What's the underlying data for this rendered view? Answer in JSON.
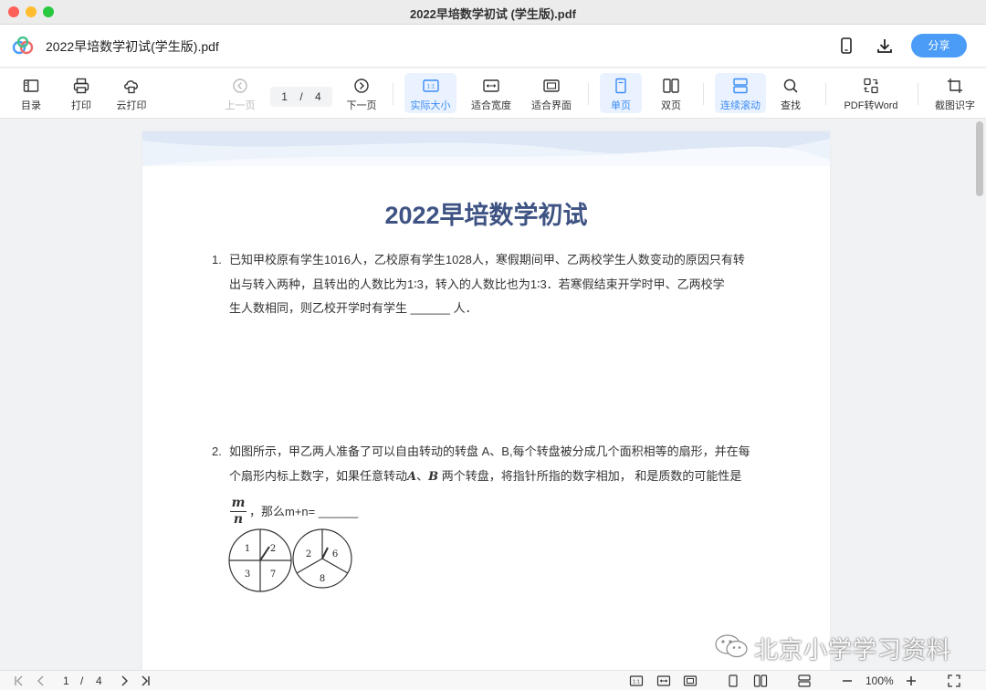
{
  "window": {
    "title": "2022早培数学初试 (学生版).pdf"
  },
  "header": {
    "doc_title": "2022早培数学初试(学生版).pdf",
    "share_label": "分享"
  },
  "toolbar": {
    "toc": "目录",
    "print": "打印",
    "cloud_print": "云打印",
    "prev_page": "上一页",
    "page_current": "1",
    "page_sep": "/",
    "page_total": "4",
    "next_page": "下一页",
    "actual_size": "实际大小",
    "fit_width": "适合宽度",
    "fit_page": "适合界面",
    "single_page": "单页",
    "double_page": "双页",
    "continuous_scroll": "连续滚动",
    "find": "查找",
    "pdf_to_word": "PDF转Word",
    "screenshot_ocr": "截图识字",
    "actual_size_badge": "1:1"
  },
  "document": {
    "title": "2022早培数学初试",
    "q1": {
      "num": "1.",
      "line1": "已知甲校原有学生1016人，乙校原有学生1028人，寒假期间甲、乙两校学生人数变动的原因只有转",
      "line2": "出与转入两种，且转出的人数比为1∶3，转入的人数比也为1∶3．若寒假结束开学时甲、乙两校学",
      "line3": "生人数相同，则乙校开学时有学生 ______ 人．"
    },
    "q2": {
      "num": "2.",
      "line1": "如图所示，甲乙两人准备了可以自由转动的转盘 A、B,每个转盘被分成几个面积相等的扇形，并在每",
      "line2_a": "个扇形内标上数字，如果任意转动",
      "line2_A": "A",
      "line2_sep": "、",
      "line2_B": "B",
      "line2_b": " 两个转盘，将指针所指的数字相加， 和是质数的可能性是",
      "frac_num": "m",
      "frac_den": "n",
      "line3": "，那么m+n= ______",
      "spinner_a": [
        "1",
        "2",
        "3",
        "7"
      ],
      "spinner_b": [
        "2",
        "6",
        "8"
      ]
    }
  },
  "watermark": {
    "text": "北京小学学习资料"
  },
  "statusbar": {
    "page_current": "1",
    "page_sep": "/",
    "page_total": "4",
    "zoom": "100%",
    "actual_size_badge": "1:1"
  }
}
